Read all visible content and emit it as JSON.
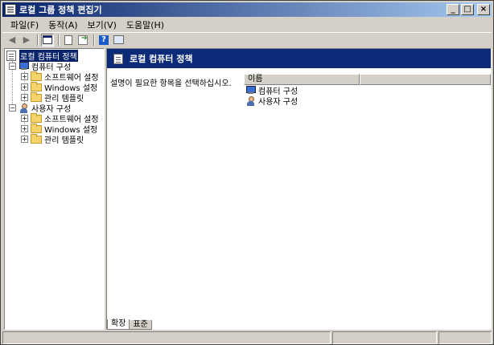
{
  "window": {
    "title": "로컬 그룹 정책 편집기",
    "min_symbol": "_",
    "max_symbol": "□",
    "close_symbol": "×"
  },
  "menu": {
    "items": [
      "파일(F)",
      "동작(A)",
      "보기(V)",
      "도움말(H)"
    ]
  },
  "toolbar": {
    "back_symbol": "◀",
    "forward_symbol": "▶",
    "help_symbol": "?"
  },
  "tree": {
    "root": "로컬 컴퓨터 정책",
    "computer_config": "컴퓨터 구성",
    "computer_children": [
      "소프트웨어 설정",
      "Windows 설정",
      "관리 템플릿"
    ],
    "user_config": "사용자 구성",
    "user_children": [
      "소프트웨어 설정",
      "Windows 설정",
      "관리 템플릿"
    ],
    "expand_symbol": "+",
    "collapse_symbol": "−"
  },
  "detail": {
    "banner_title": "로컬 컴퓨터 정책",
    "description": "설명이 필요한 항목을 선택하십시오.",
    "column_name": "이름",
    "items": [
      "컴퓨터 구성",
      "사용자 구성"
    ]
  },
  "tabs": {
    "extended": "확장",
    "standard": "표준"
  },
  "colors": {
    "title_start": "#0a246a",
    "title_end": "#a6caf0",
    "banner": "#0b2a78",
    "face": "#d4d0c8"
  }
}
